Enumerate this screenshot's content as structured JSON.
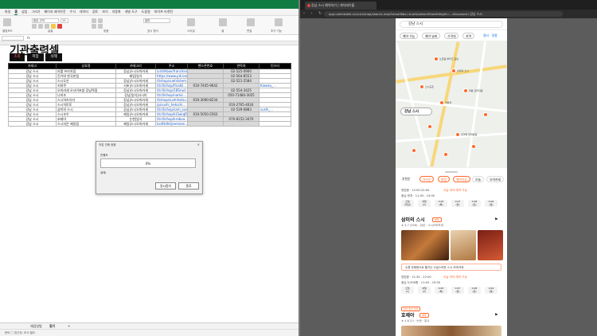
{
  "excel": {
    "ribbon_tabs": [
      "파일",
      "홈",
      "삽입",
      "그리기",
      "페이지 레이아웃",
      "수식",
      "데이터",
      "검토",
      "보기",
      "자동화",
      "개발 도구",
      "도움말",
      "파이프 타겟턴"
    ],
    "active_tab": "홈",
    "font_name": "맑은 고딕",
    "font_size": "11",
    "number_format": "일반",
    "ribbon_groups": [
      "클립보드",
      "글꼴",
      "맞춤",
      "표시 형식",
      "스타일",
      "셀",
      "편집",
      "추가 기능"
    ],
    "sheet_title": "기관출력셀",
    "action_buttons": [
      "조회",
      "저장",
      "삭제"
    ],
    "columns": [
      "카테고",
      "상호명",
      "카테고리",
      "주소",
      "핸드폰번호",
      "연락처",
      "인스타"
    ],
    "rows": [
      [
        "강남 스시",
        "라를 프라자점",
        "강남|스시오마카세",
        "Listdhbox/franchise...",
        "",
        "02-525-0900",
        ""
      ],
      [
        "강남 스시",
        "진가와 한국본점",
        "제일|일식",
        "https://www.pik.kesiri...",
        "",
        "02-564-8553",
        ""
      ],
      [
        "강남 스시",
        "스시도온",
        "강남|스시오마카세",
        "/t/shop/suehlistem...",
        "",
        "02-521-5584",
        ""
      ],
      [
        "강남 스시",
        "키와쿠",
        "서초|스시오마카세",
        "/t/c0/shop/finalkl...",
        "010-7445-9642",
        "",
        "Kiwaku_..."
      ],
      [
        "강남 스시",
        "오마카세 오사이초밥 강남역점",
        "강남|스시오마카세",
        "/t/c0/shop/18SnwI...",
        "",
        "02-554-3425",
        ""
      ],
      [
        "강남 스시",
        "나미조",
        "강남|일식|사시미",
        "/t/c0/shop/namic...",
        "",
        "050-71484-3025",
        ""
      ],
      [
        "강남 스시",
        "스시하츠유키",
        "강남|스시오마카세",
        "/t/shop/sushihatsu...",
        "010-3090-8234",
        "",
        ""
      ],
      [
        "강남 스시",
        "스시히토토",
        "강남|스시오마카세",
        "/p/sushi_hetochi...",
        "",
        "010-2765-4024",
        ""
      ],
      [
        "강남 스시",
        "삼미의 스시",
        "강남|스시오마카세",
        "/t/c0/shop/sam_sushi...",
        "",
        "02-539-0883",
        "sushi_..."
      ],
      [
        "강남 스시",
        "스시조우",
        "제일|스시오마카세",
        "/t/c0/shop/kt3ukqR...",
        "010-5050-2563",
        "",
        ""
      ],
      [
        "강남 스시",
        "호제아",
        "논현|일식",
        "/t/c0/shop/kraboa...",
        "",
        "070-8152-3470",
        ""
      ],
      [
        "강남 스시",
        "스시지은 제일점",
        "제일|스시오마카세",
        "ksdttdht/jeemeen...",
        "",
        "",
        ""
      ]
    ],
    "dialog": {
      "title": "작업 진행 현황",
      "label_progress": "진행도",
      "progress_percent": "0%",
      "progress_fraction": 0,
      "label_status": "상태:",
      "btn_stop": "일시중지",
      "btn_close": "종료"
    },
    "sheet_tabs": [
      "재검방법",
      "찾기"
    ],
    "active_sheet": "찾기",
    "status_text": "준비 □ 접근성: 조사 필요"
  },
  "browser": {
    "tab_title": "강남 스시 예약하기 | 캐치테이블",
    "url": "app.catchtable.co.kr/ct/map/search-map?showTabs=true&bottomSheetHeight=...&keyword=강남 스시",
    "search_text": "강남 스시",
    "filters": [
      "예약 가능",
      "예약 날짜",
      "가격대",
      "지역"
    ],
    "filter_right": "필터 · 정렬",
    "map_labels": [
      "노트럼 부티크 강남",
      "삼미의 스시",
      "스시도온",
      "라를 프라자점",
      "키와쿠",
      "진가와 한국본점"
    ],
    "map_chip": "강남 스시",
    "chips": [
      "추천순",
      "거리순",
      "평점",
      "예약가능",
      "오늘",
      "오마카세"
    ],
    "card1": {
      "hours1": "영업중 · 12:00-22:00",
      "notice1": "오늘 저녁 예약 가능",
      "hours2": "점심 런치 · 11:45 - 15:00",
      "slots": [
        [
          "오늘",
          "(마감)"
        ],
        [
          "내일",
          "(2)"
        ],
        [
          "0.05",
          "(목)"
        ],
        [
          "0.07",
          "(금)"
        ],
        [
          "0.08",
          "(토)"
        ],
        [
          "0.09",
          "(일)"
        ]
      ]
    },
    "card2": {
      "name": "삼미의 스시",
      "badge": "예약",
      "meta": "★ 4.7 (456) · 강남 · 스시오마카세",
      "promo": "수룩 무제한으로 즐기는 고급스러운 스시 오마카세",
      "hours1": "영업중 · 11:30 - 22:00",
      "notice1": "오늘 저녁 예약 가능",
      "hours2": "점심 5,900원 · 11:45 - 15:00",
      "slots": [
        [
          "오늘",
          "(1)"
        ],
        [
          "내일",
          "(2)"
        ],
        [
          "0.05",
          "(목)"
        ],
        [
          "0.07",
          "(금)"
        ],
        [
          "0.08",
          "(토)"
        ],
        [
          "0.09",
          "(일)"
        ]
      ]
    },
    "card3": {
      "tag": "런치 런치 런치",
      "name": "호제아",
      "badge": "예약",
      "meta": "★ 4.6 (2) · 논현 · 일식"
    },
    "colors": {
      "accent": "#ff6a2b",
      "excel": "#107c41"
    }
  }
}
